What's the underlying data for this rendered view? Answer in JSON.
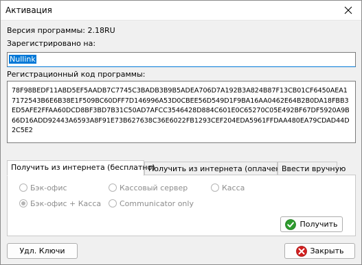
{
  "window": {
    "title": "Активация"
  },
  "version_label": "Версия программы: 2.18RU",
  "registered_label": "Зарегистрировано на:",
  "registered_value": "Nullink",
  "code_label": "Регистрационный код программы:",
  "code_value": "78F98BEDF11ABD5EF5AADB7C7745C3BADB3B9B5ADEA706D7A192B3A824B87F13CB01CF6450AEA17172543B6E6B38E1F509BC60DFF7D146996A53D0CBEE56D549D1F9BA16AA0462E64B2B0DA18FBB3ED5AFE2FFAA60DCD8BF3BD7B31C50AD7AFCC3546428D884C601E0C65270C05E492BF67DF5920A9B66D16ADD92443A6593A8F91E73B627638C36E6022FB1293CEF204EDA5961FFDAA480EA79CDAD44D2C5E2",
  "tabs": [
    {
      "label": "Получить из интернета (бесплатно)",
      "active": true
    },
    {
      "label": "Получить из интернета (оплачено)",
      "active": false
    },
    {
      "label": "Ввести вручную",
      "active": false
    }
  ],
  "options": {
    "backoffice": "Бэк-офис",
    "cash_server": "Кассовый сервер",
    "kassa": "Касса",
    "backoffice_kassa": "Бэк-офис + Касса",
    "communicator": "Communicator only",
    "selected": "backoffice_kassa"
  },
  "buttons": {
    "get": "Получить",
    "remove_keys": "Удл. Ключи",
    "close": "Закрыть"
  },
  "icons": {
    "title_close": "close-icon",
    "get": "green-checkmark-icon",
    "close": "red-no-entry-icon"
  },
  "colors": {
    "selection": "#0078d7",
    "green": "#2e9b2e",
    "red": "#d21f1f"
  }
}
